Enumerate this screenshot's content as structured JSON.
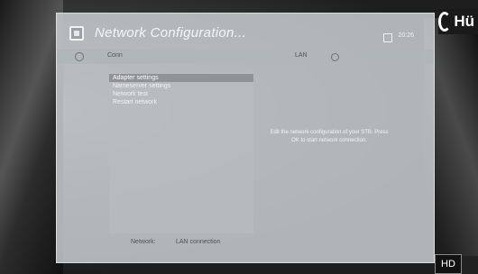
{
  "channel": {
    "logo_text": "Hü",
    "badge": "HD"
  },
  "panel": {
    "title": "Network Configuration...",
    "time": "20:26",
    "status_label": "Conn",
    "status_right": "LAN"
  },
  "menu": {
    "items": [
      {
        "label": "Adapter settings",
        "selected": true
      },
      {
        "label": "Nameserver settings",
        "selected": false
      },
      {
        "label": "Network test",
        "selected": false
      },
      {
        "label": "Restart network",
        "selected": false
      }
    ]
  },
  "info": {
    "text": "Edit the network configuration of your STB. Press OK to start network connection."
  },
  "footer": {
    "label": "Network:",
    "value": "LAN connection"
  }
}
